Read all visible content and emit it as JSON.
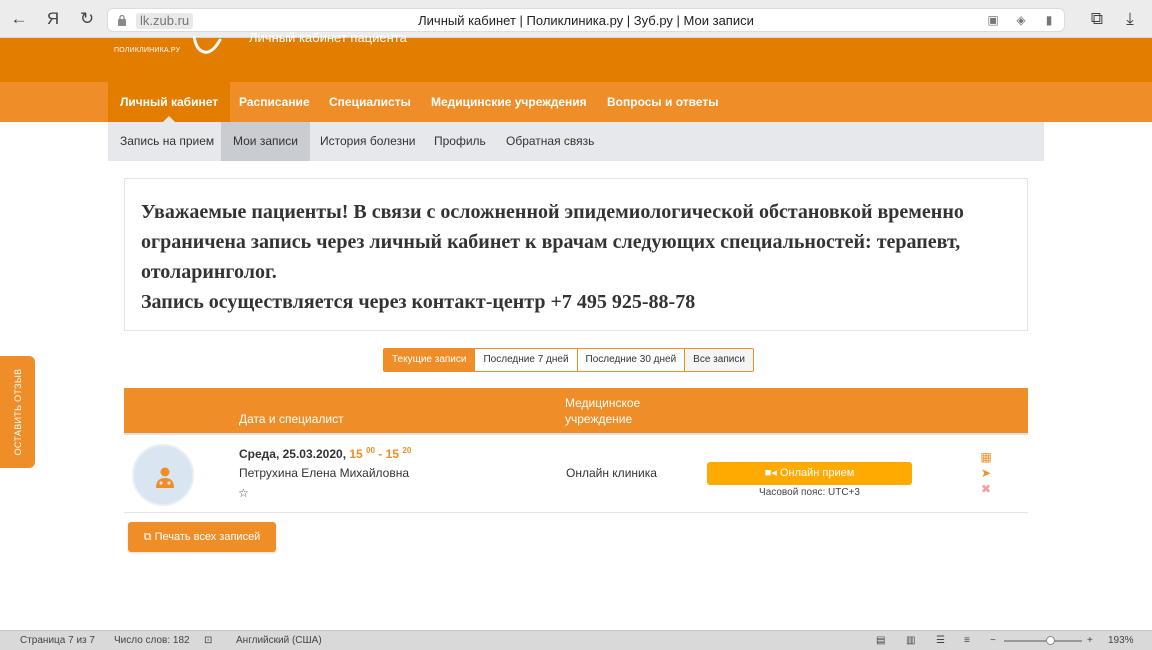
{
  "browser": {
    "back": "←",
    "yandex": "Я",
    "reload": "↻",
    "domain": "lk.zub.ru",
    "tab_title": "Личный кабинет | Поликлиника.ру | Зуб.ру | Мои записи"
  },
  "site": {
    "logo_text": "ПОЛИКЛИНИКА.РУ",
    "cabinet_title": "Личный кабинет пациента"
  },
  "main_nav": [
    {
      "label": "Личный кабинет"
    },
    {
      "label": "Расписание"
    },
    {
      "label": "Специалисты"
    },
    {
      "label": "Медицинские учреждения"
    },
    {
      "label": "Вопросы и ответы"
    }
  ],
  "sub_nav": [
    {
      "label": "Запись на прием"
    },
    {
      "label": "Мои записи"
    },
    {
      "label": "История болезни"
    },
    {
      "label": "Профиль"
    },
    {
      "label": "Обратная связь"
    }
  ],
  "notice": {
    "line1": "Уважаемые пациенты! В связи с осложненной эпидемиологической обстановкой временно ограничена запись через личный кабинет к врачам следующих специальностей: терапевт, отоларинголог.",
    "line2": "Запись осуществляется через контакт-центр +7 495 925-88-78"
  },
  "filters": [
    {
      "label": "Текущие записи"
    },
    {
      "label": "Последние 7 дней"
    },
    {
      "label": "Последние 30 дней"
    },
    {
      "label": "Все записи"
    }
  ],
  "table": {
    "col_date": "Дата и специалист",
    "col_clinic_1": "Медицинское",
    "col_clinic_2": "учреждение"
  },
  "appointment": {
    "date": "Среда, 25.03.2020,",
    "start_hour": "15",
    "start_min": "00",
    "dash": "-",
    "end_hour": "15",
    "end_min": "20",
    "doctor": "Петрухина Елена Михайловна",
    "star": "☆",
    "clinic": "Онлайн клиника",
    "online_button": "Онлайн прием",
    "timezone": "Часовой пояс: UTC+3"
  },
  "print_all": "Печать всех записей",
  "feedback": "ОСТАВИТЬ ОТЗЫВ",
  "status_bar": {
    "page": "Страница 7 из 7",
    "words": "Число слов: 182",
    "language": "Английский (США)",
    "zoom": "193%"
  },
  "colors": {
    "header": "#e27d00",
    "nav": "#ef8e28",
    "online_button": "#ffaa00"
  }
}
